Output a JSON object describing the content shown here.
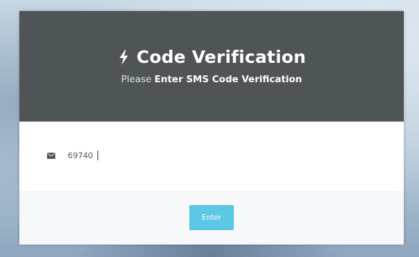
{
  "header": {
    "title": "Code Verification",
    "subtitle_prefix": "Please ",
    "subtitle_strong": "Enter SMS Code Verification"
  },
  "form": {
    "code_value": "69740",
    "input_icon": "envelope-icon"
  },
  "footer": {
    "enter_label": "Enter"
  },
  "icons": {
    "title_icon": "bolt-icon"
  },
  "colors": {
    "header_bg": "#4f5557",
    "button_bg": "#5bc8e6",
    "footer_bg": "#f6f8fa"
  }
}
